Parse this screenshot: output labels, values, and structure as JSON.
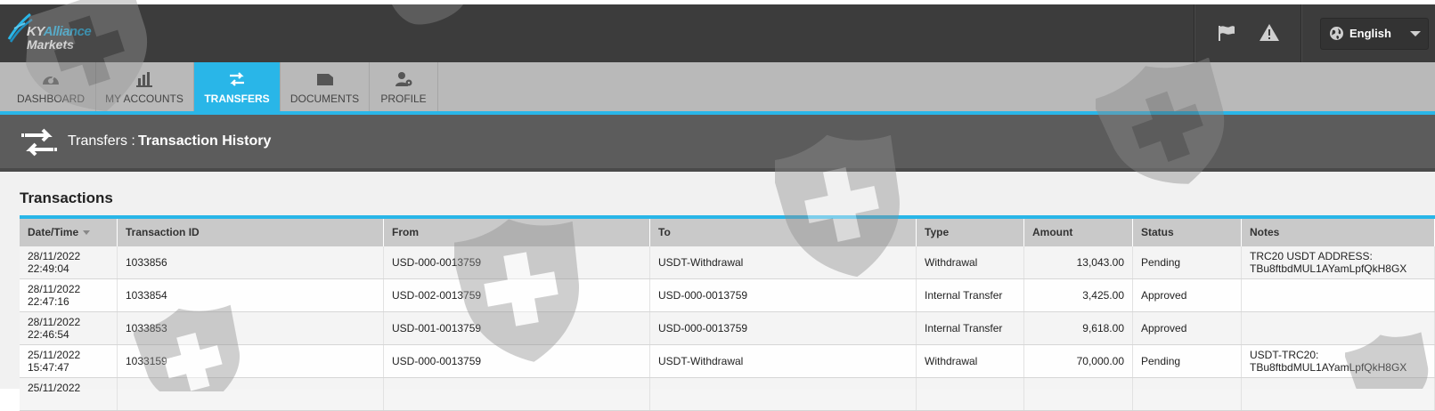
{
  "brand": {
    "name_part1": "KY",
    "name_part2": "Alliance",
    "name_line2": "Markets"
  },
  "topbar": {
    "language": "English"
  },
  "nav": {
    "tabs": [
      {
        "label": "DASHBOARD",
        "icon": "dashboard-gauge-icon"
      },
      {
        "label": "MY ACCOUNTS",
        "icon": "bar-chart-icon"
      },
      {
        "label": "TRANSFERS",
        "icon": "transfer-arrows-icon",
        "active": true
      },
      {
        "label": "DOCUMENTS",
        "icon": "folder-icon"
      },
      {
        "label": "PROFILE",
        "icon": "user-settings-icon"
      }
    ]
  },
  "header": {
    "section": "Transfers :",
    "page": "Transaction History"
  },
  "transactions": {
    "title": "Transactions",
    "columns": [
      "Date/Time",
      "Transaction ID",
      "From",
      "To",
      "Type",
      "Amount",
      "Status",
      "Notes"
    ],
    "rows": [
      {
        "date": "28/11/2022",
        "time": "22:49:04",
        "id": "1033856",
        "from": "USD-000-0013759",
        "to": "USDT-Withdrawal",
        "type": "Withdrawal",
        "amount": "13,043.00",
        "status": "Pending",
        "notes1": "TRC20 USDT ADDRESS:",
        "notes2": "TBu8ftbdMUL1AYamLpfQkH8GX"
      },
      {
        "date": "28/11/2022",
        "time": "22:47:16",
        "id": "1033854",
        "from": "USD-002-0013759",
        "to": "USD-000-0013759",
        "type": "Internal Transfer",
        "amount": "3,425.00",
        "status": "Approved",
        "notes1": "",
        "notes2": ""
      },
      {
        "date": "28/11/2022",
        "time": "22:46:54",
        "id": "1033853",
        "from": "USD-001-0013759",
        "to": "USD-000-0013759",
        "type": "Internal Transfer",
        "amount": "9,618.00",
        "status": "Approved",
        "notes1": "",
        "notes2": ""
      },
      {
        "date": "25/11/2022",
        "time": "15:47:47",
        "id": "1033159",
        "from": "USD-000-0013759",
        "to": "USDT-Withdrawal",
        "type": "Withdrawal",
        "amount": "70,000.00",
        "status": "Pending",
        "notes1": "USDT-TRC20:",
        "notes2": "TBu8ftbdMUL1AYamLpfQkH8GX"
      },
      {
        "date": "25/11/2022",
        "time": "",
        "id": "",
        "from": "",
        "to": "",
        "type": "",
        "amount": "",
        "status": "",
        "notes1": "",
        "notes2": ""
      }
    ]
  },
  "colors": {
    "accent": "#29b6e8",
    "topbar": "#3c3c3c",
    "nav": "#b9b9b9",
    "header": "#5c5c5c"
  }
}
